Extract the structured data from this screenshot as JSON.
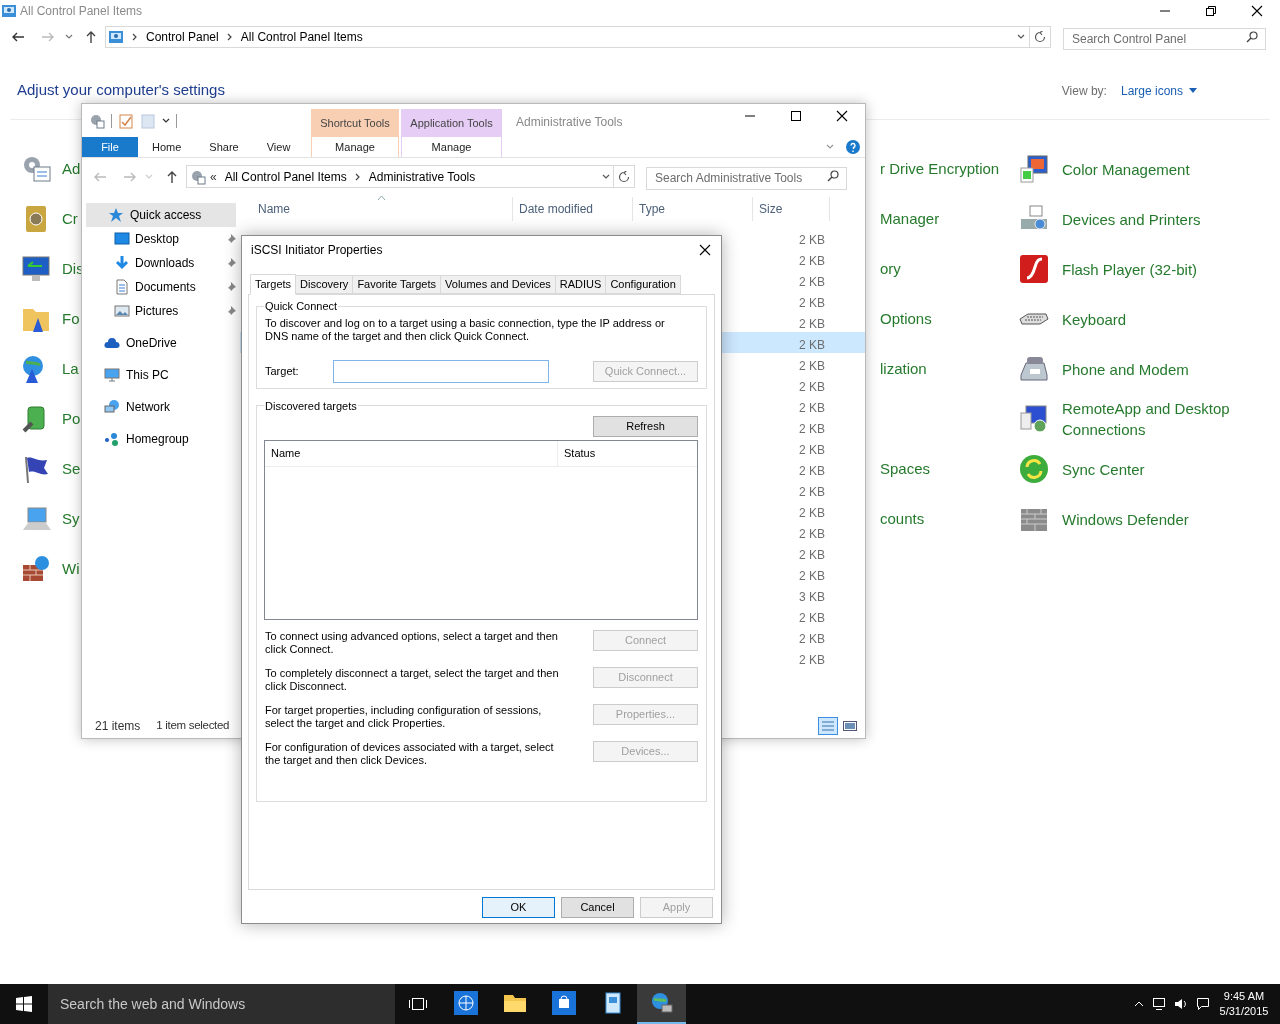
{
  "control_panel": {
    "title": "All Control Panel Items",
    "breadcrumbs": [
      "Control Panel",
      "All Control Panel Items"
    ],
    "search": {
      "placeholder": "Search Control Panel"
    },
    "heading": "Adjust your computer's settings",
    "view_by": {
      "label": "View by:",
      "value": "Large icons"
    },
    "rows": [
      {
        "left": "Ad",
        "middle": "r Drive Encryption",
        "right": "Color Management"
      },
      {
        "left": "Cr",
        "middle": "Manager",
        "right": "Devices and Printers"
      },
      {
        "left": "Dis",
        "middle": "ory",
        "right": "Flash Player (32-bit)"
      },
      {
        "left": "Fo",
        "middle": "Options",
        "right": "Keyboard"
      },
      {
        "left": "La",
        "middle": "lization",
        "right": "Phone and Modem"
      },
      {
        "left": "Po",
        "right": "RemoteApp and Desktop Connections"
      },
      {
        "left": "Se",
        "middle": "Spaces",
        "right": "Sync Center"
      },
      {
        "left": "Sy",
        "middle": "counts",
        "right": "Windows Defender"
      },
      {
        "left": "Wi"
      }
    ]
  },
  "explorer": {
    "title": "Administrative Tools",
    "tool_groups": [
      {
        "group": "Shortcut Tools",
        "tab": "Manage",
        "color": "#f9cfb4"
      },
      {
        "group": "Application Tools",
        "tab": "Manage",
        "color": "#e6cdf5"
      }
    ],
    "ribbon_tabs": [
      {
        "label": "File",
        "kind": "file"
      },
      {
        "label": "Home",
        "kind": "tab"
      },
      {
        "label": "Share",
        "kind": "tab"
      },
      {
        "label": "View",
        "kind": "tab"
      }
    ],
    "overflow_mark": "«",
    "breadcrumbs": [
      "All Control Panel Items",
      "Administrative Tools"
    ],
    "search": {
      "placeholder": "Search Administrative Tools"
    },
    "nav": [
      {
        "label": "Quick access",
        "selected": true,
        "children": [
          {
            "label": "Desktop",
            "pinned": true
          },
          {
            "label": "Downloads",
            "pinned": true
          },
          {
            "label": "Documents",
            "pinned": true
          },
          {
            "label": "Pictures",
            "pinned": true
          }
        ]
      },
      {
        "label": "OneDrive",
        "selected": false
      },
      {
        "label": "This PC",
        "selected": false
      },
      {
        "label": "Network",
        "selected": false
      },
      {
        "label": "Homegroup",
        "selected": false
      }
    ],
    "columns": [
      "Name",
      "Date modified",
      "Type",
      "Size"
    ],
    "rows": [
      {
        "size": "2 KB",
        "selected": false
      },
      {
        "size": "2 KB",
        "selected": false
      },
      {
        "size": "2 KB",
        "selected": false
      },
      {
        "size": "2 KB",
        "selected": false
      },
      {
        "size": "2 KB",
        "selected": false
      },
      {
        "size": "2 KB",
        "selected": true
      },
      {
        "size": "2 KB",
        "selected": false
      },
      {
        "size": "2 KB",
        "selected": false
      },
      {
        "size": "2 KB",
        "selected": false
      },
      {
        "size": "2 KB",
        "selected": false
      },
      {
        "size": "2 KB",
        "selected": false
      },
      {
        "size": "2 KB",
        "selected": false
      },
      {
        "size": "2 KB",
        "selected": false
      },
      {
        "size": "2 KB",
        "selected": false
      },
      {
        "size": "2 KB",
        "selected": false
      },
      {
        "size": "2 KB",
        "selected": false
      },
      {
        "size": "2 KB",
        "selected": false
      },
      {
        "size": "3 KB",
        "selected": false
      },
      {
        "size": "2 KB",
        "selected": false
      },
      {
        "size": "2 KB",
        "selected": false
      },
      {
        "size": "2 KB",
        "selected": false
      }
    ],
    "status": {
      "count": "21 items",
      "selection": "1 item selected"
    }
  },
  "dialog": {
    "title": "iSCSI Initiator Properties",
    "tabs": [
      {
        "label": "Targets",
        "selected": true
      },
      {
        "label": "Discovery",
        "selected": false
      },
      {
        "label": "Favorite Targets",
        "selected": false
      },
      {
        "label": "Volumes and Devices",
        "selected": false
      },
      {
        "label": "RADIUS",
        "selected": false
      },
      {
        "label": "Configuration",
        "selected": false
      }
    ],
    "quick_connect": {
      "legend": "Quick Connect",
      "text": "To discover and log on to a target using a basic connection, type the IP address or DNS name of the target and then click Quick Connect.",
      "target_label": "Target:",
      "button": {
        "label": "Quick Connect...",
        "disabled": true
      }
    },
    "discovered": {
      "legend": "Discovered targets",
      "refresh": {
        "label": "Refresh",
        "disabled": false
      },
      "columns": [
        "Name",
        "Status"
      ],
      "actions": [
        {
          "text": "To connect using advanced options, select a target and then click Connect.",
          "button": {
            "label": "Connect",
            "disabled": true
          }
        },
        {
          "text": "To completely disconnect a target, select the target and then click Disconnect.",
          "button": {
            "label": "Disconnect",
            "disabled": true
          }
        },
        {
          "text": "For target properties, including configuration of sessions, select the target and click Properties.",
          "button": {
            "label": "Properties...",
            "disabled": true
          }
        },
        {
          "text": "For configuration of devices associated with a target, select the target and then click Devices.",
          "button": {
            "label": "Devices...",
            "disabled": true
          }
        }
      ]
    },
    "buttons": [
      {
        "label": "OK",
        "disabled": false,
        "default": true
      },
      {
        "label": "Cancel",
        "disabled": false,
        "default": false
      },
      {
        "label": "Apply",
        "disabled": true,
        "default": false
      }
    ]
  },
  "taskbar": {
    "search_placeholder": "Search the web and Windows",
    "apps": [
      {
        "active": false
      },
      {
        "active": false
      },
      {
        "active": false
      },
      {
        "active": false
      },
      {
        "active": true
      }
    ],
    "time": "9:45 AM",
    "date": "5/31/2015"
  }
}
